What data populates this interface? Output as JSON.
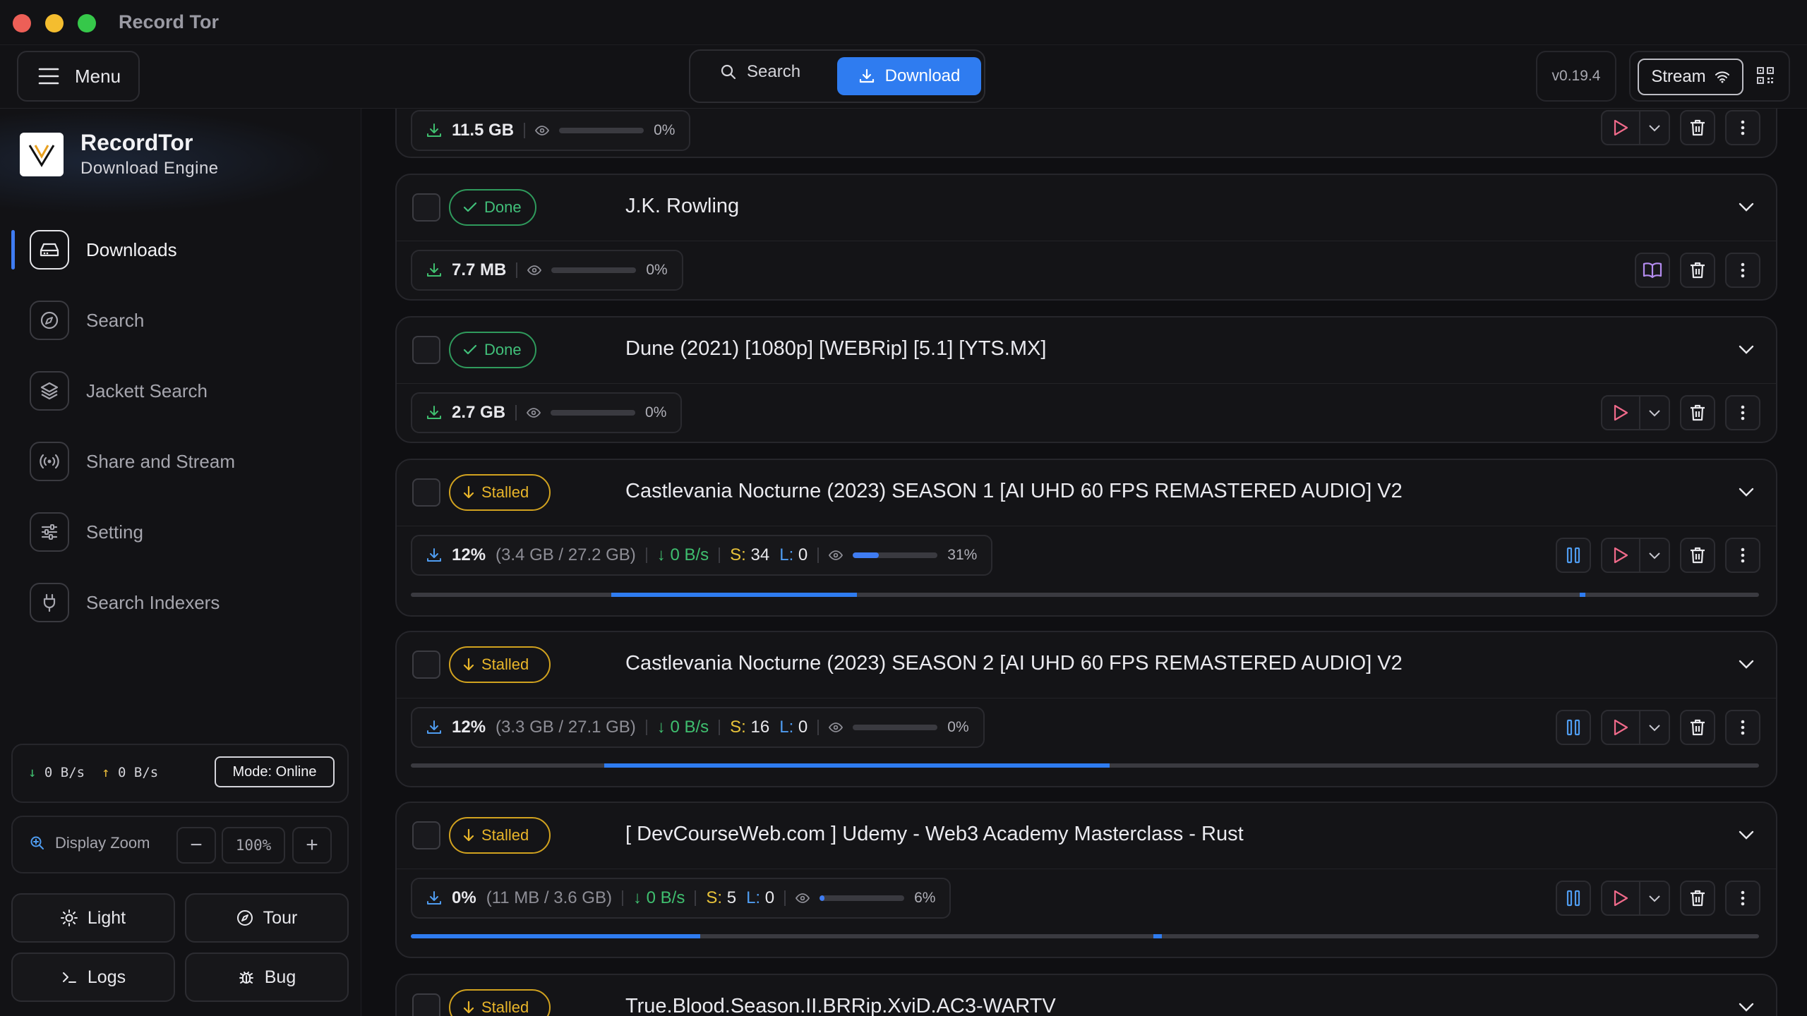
{
  "window": {
    "title": "Record Tor"
  },
  "topbar": {
    "menu_label": "Menu",
    "search_tab": "Search",
    "download_tab": "Download",
    "version": "v0.19.4",
    "stream_label": "Stream"
  },
  "sidebar": {
    "brand_name": "RecordTor",
    "brand_sub": "Download Engine",
    "items": [
      {
        "label": "Downloads",
        "icon": "drive-icon",
        "active": true
      },
      {
        "label": "Search",
        "icon": "compass-icon"
      },
      {
        "label": "Jackett Search",
        "icon": "layers-icon"
      },
      {
        "label": "Share and Stream",
        "icon": "broadcast-icon"
      },
      {
        "label": "Setting",
        "icon": "sliders-icon"
      },
      {
        "label": "Search Indexers",
        "icon": "plug-icon"
      }
    ],
    "down_rate": "0 B/s",
    "up_rate": "0 B/s",
    "mode": "Mode: Online",
    "zoom_label": "Display Zoom",
    "zoom_minus": "−",
    "zoom_value": "100%",
    "zoom_plus": "+",
    "light": "Light",
    "tour": "Tour",
    "logs": "Logs",
    "bug": "Bug"
  },
  "downloads": [
    {
      "size": "11.5 GB",
      "watch_pct": "0%"
    },
    {
      "status": "Done",
      "title": "J.K. Rowling",
      "size": "7.7 MB",
      "watch_pct": "0%"
    },
    {
      "status": "Done",
      "title": "Dune (2021) [1080p] [WEBRip] [5.1] [YTS.MX]",
      "size": "2.7 GB",
      "watch_pct": "0%"
    },
    {
      "status": "Stalled",
      "title": "Castlevania Nocturne (2023) SEASON 1 [AI UHD 60 FPS REMASTERED AUDIO] V2",
      "progress": "12%",
      "sizes": "(3.4 GB / 27.2 GB)",
      "speed": "0 B/s",
      "seeds_label": "S:",
      "seeds": "34",
      "leech_label": "L:",
      "leech": "0",
      "watch_pct": "31%",
      "watch_fraction": 0.31
    },
    {
      "status": "Stalled",
      "title": "Castlevania Nocturne (2023) SEASON 2 [AI UHD 60 FPS REMASTERED AUDIO] V2",
      "progress": "12%",
      "sizes": "(3.3 GB / 27.1 GB)",
      "speed": "0 B/s",
      "seeds_label": "S:",
      "seeds": "16",
      "leech_label": "L:",
      "leech": "0",
      "watch_pct": "0%",
      "watch_fraction": 0
    },
    {
      "status": "Stalled",
      "title": "[ DevCourseWeb.com ] Udemy - Web3 Academy Masterclass - Rust",
      "progress": "0%",
      "sizes": "(11 MB / 3.6 GB)",
      "speed": "0 B/s",
      "seeds_label": "S:",
      "seeds": "5",
      "leech_label": "L:",
      "leech": "0",
      "watch_pct": "6%",
      "watch_fraction": 0.06
    },
    {
      "status": "Stalled",
      "title": "True.Blood.Season.II.BRRip.XviD.AC3-WARTV"
    }
  ],
  "colors": {
    "accent": "#2f7cf0",
    "done": "#41c07a",
    "stalled": "#e8b52a",
    "play": "#f06a8a"
  }
}
